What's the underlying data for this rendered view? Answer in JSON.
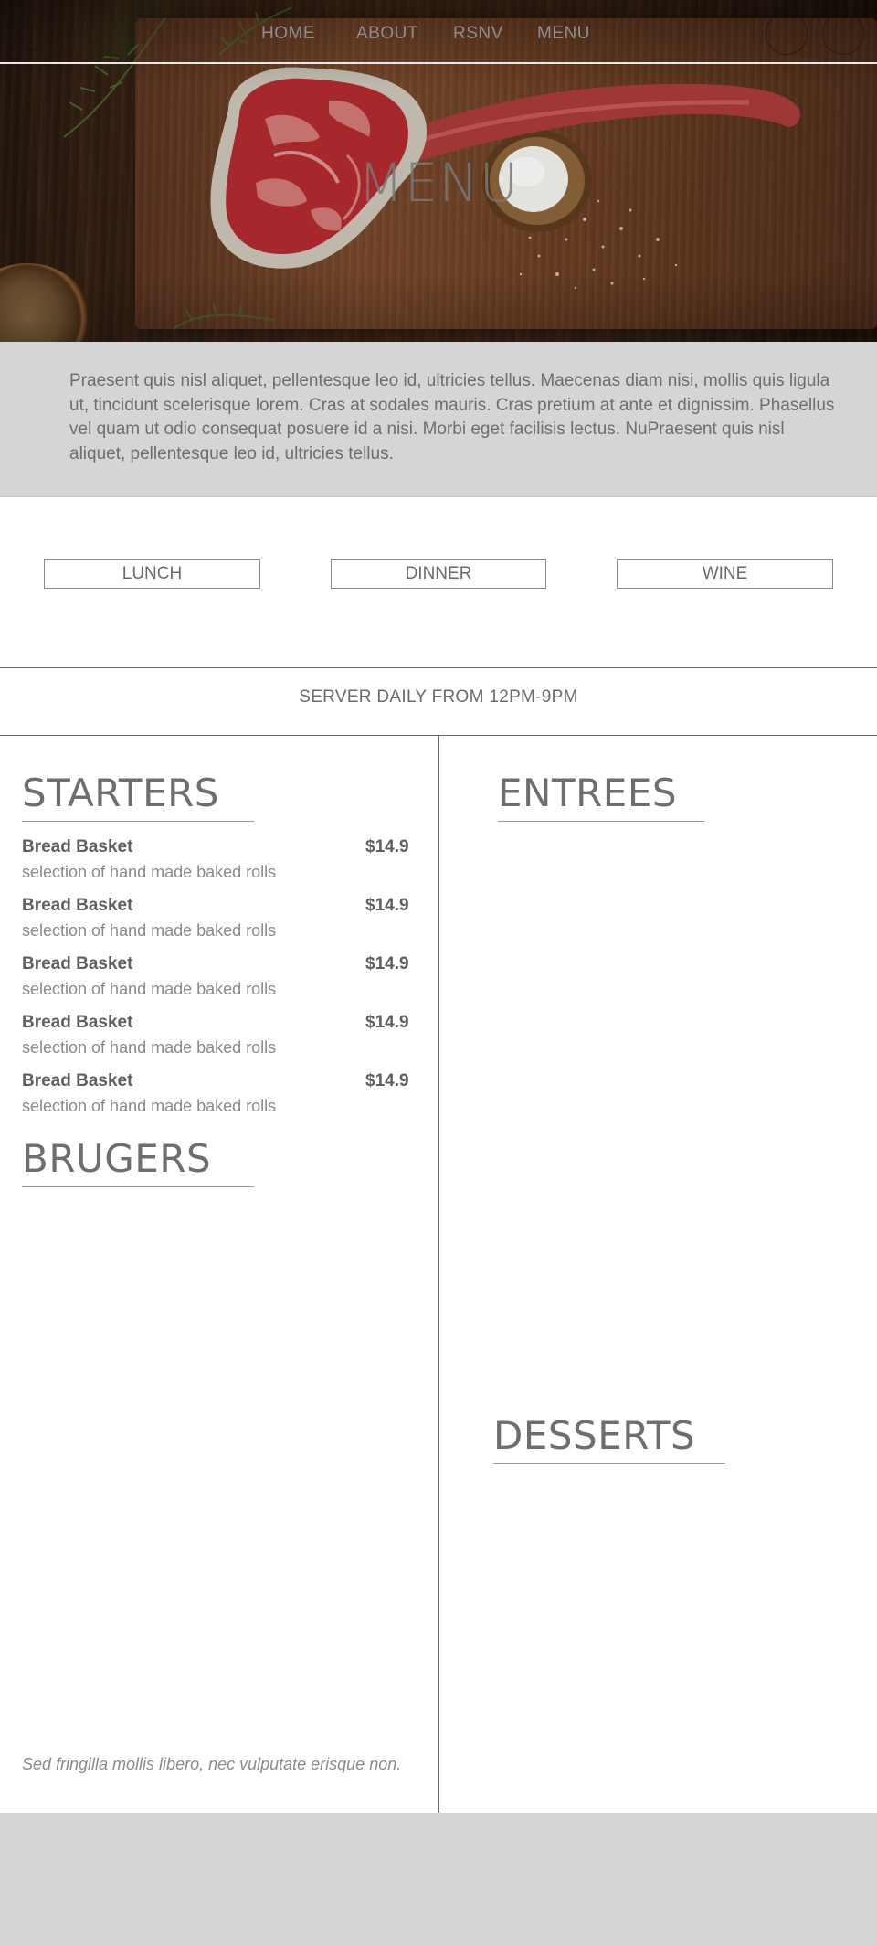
{
  "nav": {
    "links": [
      "HOME",
      "ABOUT",
      "RSNV",
      "MENU"
    ]
  },
  "hero": {
    "title": "MENU"
  },
  "intro": {
    "text": "Praesent quis nisl aliquet, pellentesque leo id, ultricies tellus. Maecenas diam nisi, mollis quis ligula ut, tincidunt scelerisque lorem. Cras at sodales mauris. Cras pretium at ante et dignissim. Phasellus vel quam ut odio consequat posuere id a nisi. Morbi eget facilisis lectus. NuPraesent quis nisl aliquet, pellentesque leo id, ultricies tellus."
  },
  "tabs": [
    "LUNCH",
    "DINNER",
    "WINE"
  ],
  "hours": "SERVER DAILY FROM 12PM-9PM",
  "sections": {
    "starters": {
      "title": "STARTERS",
      "items": [
        {
          "name": "Bread Basket",
          "price": "$14.9",
          "desc": "selection of hand made baked rolls"
        },
        {
          "name": "Bread Basket",
          "price": "$14.9",
          "desc": "selection of hand made baked rolls"
        },
        {
          "name": "Bread Basket",
          "price": "$14.9",
          "desc": "selection of hand made baked rolls"
        },
        {
          "name": "Bread Basket",
          "price": "$14.9",
          "desc": "selection of hand made baked rolls"
        },
        {
          "name": "Bread Basket",
          "price": "$14.9",
          "desc": "selection of hand made baked rolls"
        }
      ]
    },
    "burgers": {
      "title": "BRUGERS"
    },
    "entrees": {
      "title": "ENTREES"
    },
    "desserts": {
      "title": "DESSERTS"
    }
  },
  "footnote": "Sed fringilla mollis libero, nec vulputate erisque non.",
  "colors": {
    "gray_band": "#d5d5d5",
    "text": "#6a6a6a"
  }
}
